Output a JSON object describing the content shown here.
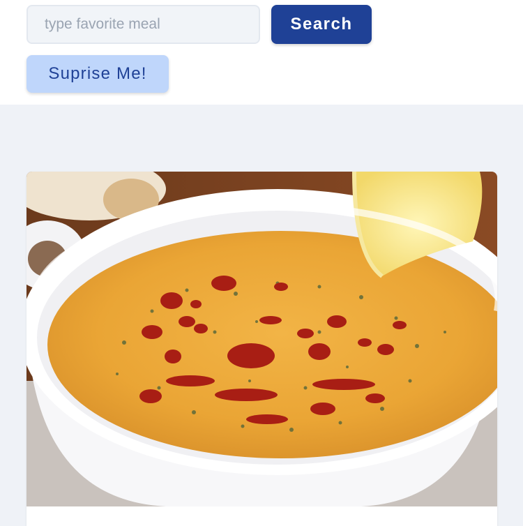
{
  "search": {
    "placeholder": "type favorite meal",
    "value": "",
    "button_label": "Search"
  },
  "surprise": {
    "button_label": "Suprise Me!"
  },
  "meal_card": {
    "image_icon": "lentil-soup-photo"
  },
  "colors": {
    "primary": "#1f4196",
    "secondary_bg": "#bfd6fb",
    "page_bg": "#eff2f7",
    "input_bg": "#f1f4f8"
  }
}
